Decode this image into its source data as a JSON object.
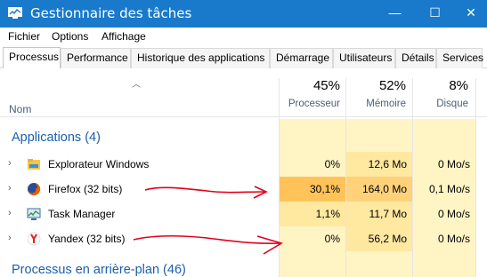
{
  "window": {
    "title": "Gestionnaire des tâches",
    "controls": {
      "minimize": "—",
      "maximize": "☐",
      "close": "✕"
    }
  },
  "menu": {
    "items": [
      "Fichier",
      "Options",
      "Affichage"
    ]
  },
  "tabs": [
    {
      "label": "Processus",
      "active": true
    },
    {
      "label": "Performance"
    },
    {
      "label": "Historique des applications"
    },
    {
      "label": "Démarrage"
    },
    {
      "label": "Utilisateurs"
    },
    {
      "label": "Détails"
    },
    {
      "label": "Services"
    }
  ],
  "columns": {
    "name": "Nom",
    "cpu": {
      "percent": "45%",
      "label": "Processeur"
    },
    "memory": {
      "percent": "52%",
      "label": "Mémoire"
    },
    "disk": {
      "percent": "8%",
      "label": "Disque"
    }
  },
  "groups": {
    "apps": "Applications (4)",
    "background": "Processus en arrière-plan (46)"
  },
  "rows": [
    {
      "name": "Explorateur Windows",
      "icon": "folder-icon",
      "cpu": "0%",
      "memory": "12,6 Mo",
      "disk": "0 Mo/s"
    },
    {
      "name": "Firefox (32 bits)",
      "icon": "firefox-icon",
      "cpu": "30,1%",
      "memory": "164,0 Mo",
      "disk": "0,1 Mo/s"
    },
    {
      "name": "Task Manager",
      "icon": "task-manager-icon",
      "cpu": "1,1%",
      "memory": "11,7 Mo",
      "disk": "0 Mo/s"
    },
    {
      "name": "Yandex (32 bits)",
      "icon": "yandex-icon",
      "cpu": "0%",
      "memory": "56,2 Mo",
      "disk": "0 Mo/s"
    }
  ],
  "colors": {
    "titlebar": "#1979ca",
    "group_text": "#1b5fae",
    "heat_light": "#fff4c4",
    "heat_medium": "#ffe8a0",
    "heat_strong": "#ffd27a",
    "heat_cpu_high": "#ffc35a",
    "annotation": "#e0001a"
  }
}
